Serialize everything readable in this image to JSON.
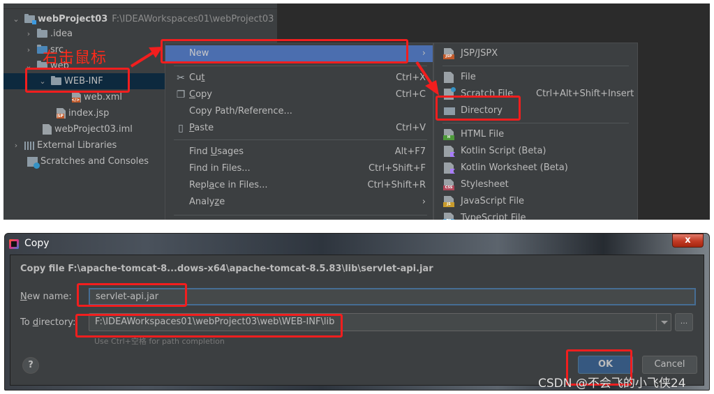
{
  "project_tree": {
    "root": {
      "name": "webProject03",
      "path": "F:\\IDEAWorkspaces01\\webProject03"
    },
    "items": [
      {
        "label": ".idea",
        "type": "folder",
        "expanded": false
      },
      {
        "label": "src",
        "type": "folder",
        "expanded": false
      },
      {
        "label": "web",
        "type": "folder",
        "expanded": true
      },
      {
        "label": "WEB-INF",
        "type": "folder",
        "expanded": true,
        "selected": true
      },
      {
        "label": "web.xml",
        "type": "xml-file"
      },
      {
        "label": "index.jsp",
        "type": "jsp-file"
      },
      {
        "label": "webProject03.iml",
        "type": "iml-file"
      },
      {
        "label": "External Libraries",
        "type": "libraries",
        "expanded": false
      },
      {
        "label": "Scratches and Consoles",
        "type": "scratches"
      }
    ]
  },
  "annotation": {
    "text": "右击鼠标",
    "color": "#ff2a1a"
  },
  "context_menu": {
    "items": [
      {
        "label": "New",
        "shortcut": "",
        "submenu": true,
        "active": true
      },
      {
        "label": "Cut",
        "mnemonic_index": 2,
        "shortcut": "Ctrl+X",
        "icon": "scissors-icon"
      },
      {
        "label": "Copy",
        "mnemonic_index": 0,
        "shortcut": "Ctrl+C",
        "icon": "copy-icon"
      },
      {
        "label": "Copy Path/Reference...",
        "shortcut": ""
      },
      {
        "label": "Paste",
        "mnemonic_index": 0,
        "shortcut": "Ctrl+V",
        "icon": "clipboard-icon"
      },
      {
        "label": "Find Usages",
        "mnemonic_index": 5,
        "shortcut": "Alt+F7"
      },
      {
        "label": "Find in Files...",
        "shortcut": "Ctrl+Shift+F"
      },
      {
        "label": "Replace in Files...",
        "mnemonic_index": 5,
        "shortcut": "Ctrl+Shift+R"
      },
      {
        "label": "Analyze",
        "mnemonic_index": 5,
        "submenu": true
      }
    ]
  },
  "new_submenu": {
    "items": [
      {
        "label": "JSP/JSPX",
        "icon": "jsp-file-icon",
        "badge": "JSP",
        "badge_color": "#c15a2b"
      },
      {
        "label": "File",
        "icon": "file-icon"
      },
      {
        "label": "Scratch File",
        "icon": "scratch-file-icon",
        "shortcut": "Ctrl+Alt+Shift+Insert"
      },
      {
        "label": "Directory",
        "icon": "folder-icon"
      },
      {
        "label": "HTML File",
        "icon": "html-file-icon",
        "badge": "H",
        "badge_color": "#4e9a3a"
      },
      {
        "label": "Kotlin Script (Beta)",
        "icon": "kotlin-icon"
      },
      {
        "label": "Kotlin Worksheet (Beta)",
        "icon": "kotlin-icon"
      },
      {
        "label": "Stylesheet",
        "icon": "css-file-icon",
        "badge": "CSS",
        "badge_color": "#b0485b"
      },
      {
        "label": "JavaScript File",
        "icon": "js-file-icon",
        "badge": "JS",
        "badge_color": "#c89b2c"
      },
      {
        "label": "TypeScript File",
        "icon": "ts-file-icon",
        "badge": "TS",
        "badge_color": "#3c8fc4"
      }
    ]
  },
  "copy_dialog": {
    "title": "Copy",
    "close_label": "x",
    "heading": "Copy file F:\\apache-tomcat-8...dows-x64\\apache-tomcat-8.5.83\\lib\\servlet-api.jar",
    "new_name": {
      "label_mnemonic": "N",
      "label_rest": "ew name:",
      "value": "servlet-api.jar"
    },
    "to_directory": {
      "label_prefix": "To ",
      "label_mnemonic": "d",
      "label_rest": "irectory:",
      "value": "F:\\IDEAWorkspaces01\\webProject03\\web\\WEB-INF\\lib"
    },
    "hint": "Use Ctrl+空格 for path completion",
    "browse_label": "...",
    "help_label": "?",
    "ok_label": "OK",
    "cancel_label": "Cancel"
  },
  "watermark": "CSDN @不会飞的小飞侠24"
}
